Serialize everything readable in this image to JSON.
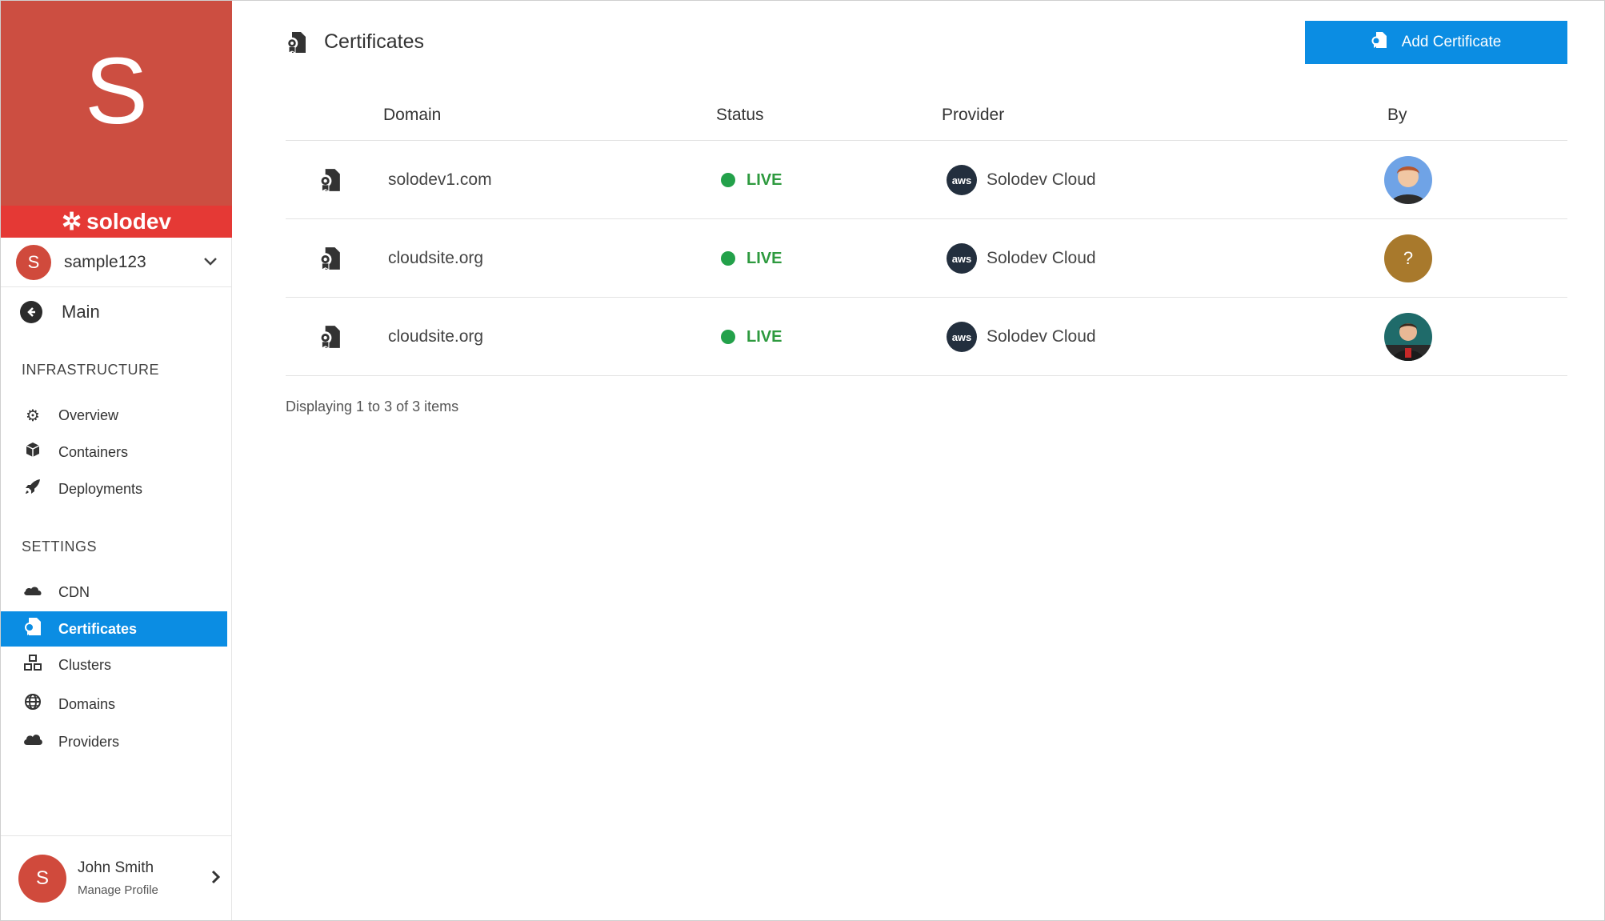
{
  "brand": {
    "letter": "S",
    "logo_text": "solodev"
  },
  "account": {
    "avatar_letter": "S",
    "name": "sample123"
  },
  "nav": {
    "main_label": "Main",
    "infrastructure_label": "INFRASTRUCTURE",
    "settings_label": "SETTINGS",
    "infrastructure_items": [
      {
        "label": "Overview",
        "icon": "gears-icon"
      },
      {
        "label": "Containers",
        "icon": "cube-icon"
      },
      {
        "label": "Deployments",
        "icon": "rocket-icon"
      }
    ],
    "settings_items": [
      {
        "label": "CDN",
        "icon": "cloud-icon"
      },
      {
        "label": "Certificates",
        "icon": "certificate-icon",
        "active": true
      },
      {
        "label": "Clusters",
        "icon": "cubes-icon"
      },
      {
        "label": "Domains",
        "icon": "globe-icon"
      },
      {
        "label": "Providers",
        "icon": "cloud-icon"
      }
    ]
  },
  "profile": {
    "avatar_letter": "S",
    "name": "John Smith",
    "subtitle": "Manage Profile"
  },
  "page": {
    "title": "Certificates",
    "add_button_label": "Add Certificate"
  },
  "table": {
    "columns": {
      "domain": "Domain",
      "status": "Status",
      "provider": "Provider",
      "by": "By"
    },
    "rows": [
      {
        "domain": "solodev1.com",
        "status": "LIVE",
        "provider_badge": "aws",
        "provider": "Solodev Cloud",
        "by": ""
      },
      {
        "domain": "cloudsite.org",
        "status": "LIVE",
        "provider_badge": "aws",
        "provider": "Solodev Cloud",
        "by": "?"
      },
      {
        "domain": "cloudsite.org",
        "status": "LIVE",
        "provider_badge": "aws",
        "provider": "Solodev Cloud",
        "by": ""
      }
    ],
    "footer": "Displaying 1 to 3 of 3 items"
  },
  "colors": {
    "brand_red": "#cc4e41",
    "strip_red": "#e53935",
    "accent_blue": "#0b8de3",
    "live_green": "#23a14a",
    "unknown_avatar": "#a8792c"
  }
}
